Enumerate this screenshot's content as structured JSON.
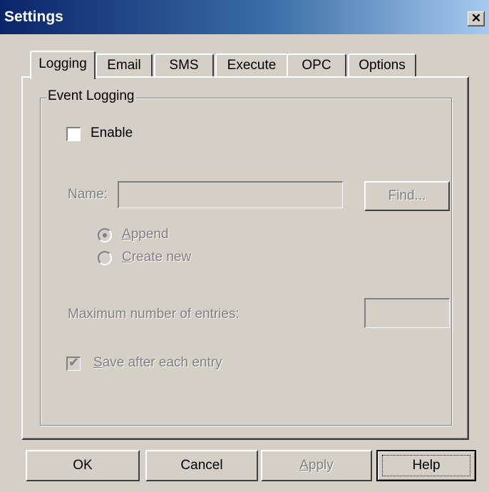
{
  "window": {
    "title": "Settings",
    "close_glyph": "✕"
  },
  "tabs": [
    {
      "label": "Logging",
      "active": true
    },
    {
      "label": "Email",
      "active": false
    },
    {
      "label": "SMS",
      "active": false
    },
    {
      "label": "Execute",
      "active": false
    },
    {
      "label": "OPC",
      "active": false
    },
    {
      "label": "Options",
      "active": false
    }
  ],
  "event_logging": {
    "group_label": "Event Logging",
    "enable": {
      "label": "Enable",
      "checked": false
    },
    "name": {
      "label": "Name:",
      "value": ""
    },
    "find_button": "Find...",
    "radios": [
      {
        "label_underlined": "A",
        "label_rest": "ppend",
        "selected": true
      },
      {
        "label_underlined": "C",
        "label_rest": "reate new",
        "selected": false
      }
    ],
    "max_entries": {
      "label": "Maximum number of entries:",
      "value": ""
    },
    "save_after_each": {
      "label_underlined": "S",
      "label_rest": "ave after each entry",
      "checked": true
    }
  },
  "buttons": {
    "ok": "OK",
    "cancel": "Cancel",
    "apply_underlined": "A",
    "apply_rest": "pply",
    "help": "Help"
  }
}
